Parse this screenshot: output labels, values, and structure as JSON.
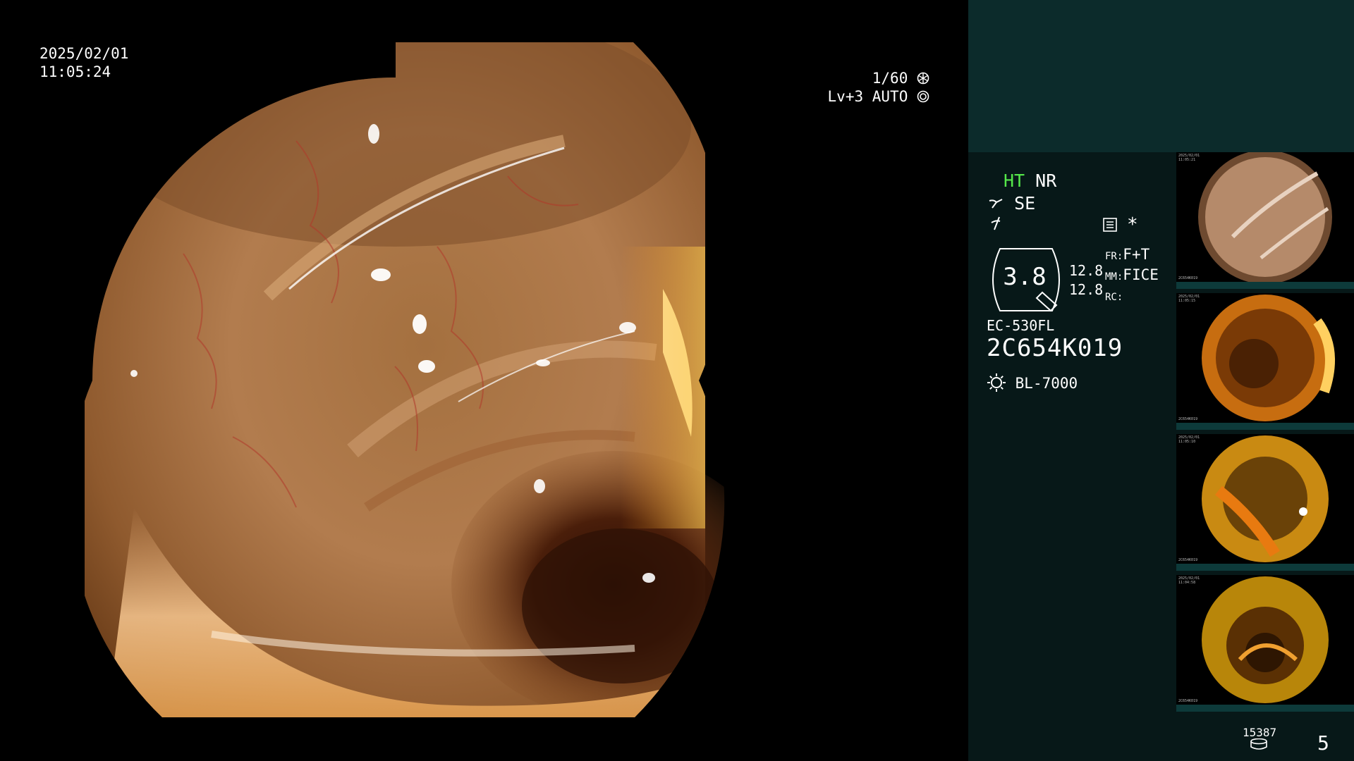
{
  "osd": {
    "date": "2025/02/01",
    "time": "11:05:24",
    "shutter": "1/60",
    "level": "Lv+3",
    "iris_mode": "AUTO"
  },
  "info": {
    "ht": "HT",
    "nr": "NR",
    "se": "SE",
    "zoom": "3.8",
    "val1": "12.8",
    "val2": "12.8",
    "fr_label": "FR:",
    "fr_value": "F+T",
    "mm_label": "MM:",
    "mm_value": "FICE",
    "rc_label": "RC:",
    "rc_value": "",
    "scope_model": "EC-530FL",
    "serial": "2C654K019",
    "light_source": "BL-7000",
    "asterisk": "*"
  },
  "footer": {
    "storage_count": "15387",
    "image_count": "5"
  },
  "thumbnails": [
    {
      "name": "thumbnail-1",
      "date": "2025/02/01",
      "time": "11:05:21",
      "serial": "2C654K019",
      "index": "4"
    },
    {
      "name": "thumbnail-2",
      "date": "2025/02/01",
      "time": "11:05:15",
      "serial": "2C654K019",
      "index": "3"
    },
    {
      "name": "thumbnail-3",
      "date": "2025/02/01",
      "time": "11:05:10",
      "serial": "2C654K019",
      "index": "2"
    },
    {
      "name": "thumbnail-4",
      "date": "2025/02/01",
      "time": "11:04:58",
      "serial": "2C654K019",
      "index": "1"
    }
  ],
  "icons": {
    "shutter": "aperture-icon",
    "iris": "iris-icon",
    "se": "enhance-icon",
    "sharp": "sharpness-icon",
    "menu": "menu-icon",
    "light": "lamp-icon",
    "storage": "storage-icon"
  }
}
